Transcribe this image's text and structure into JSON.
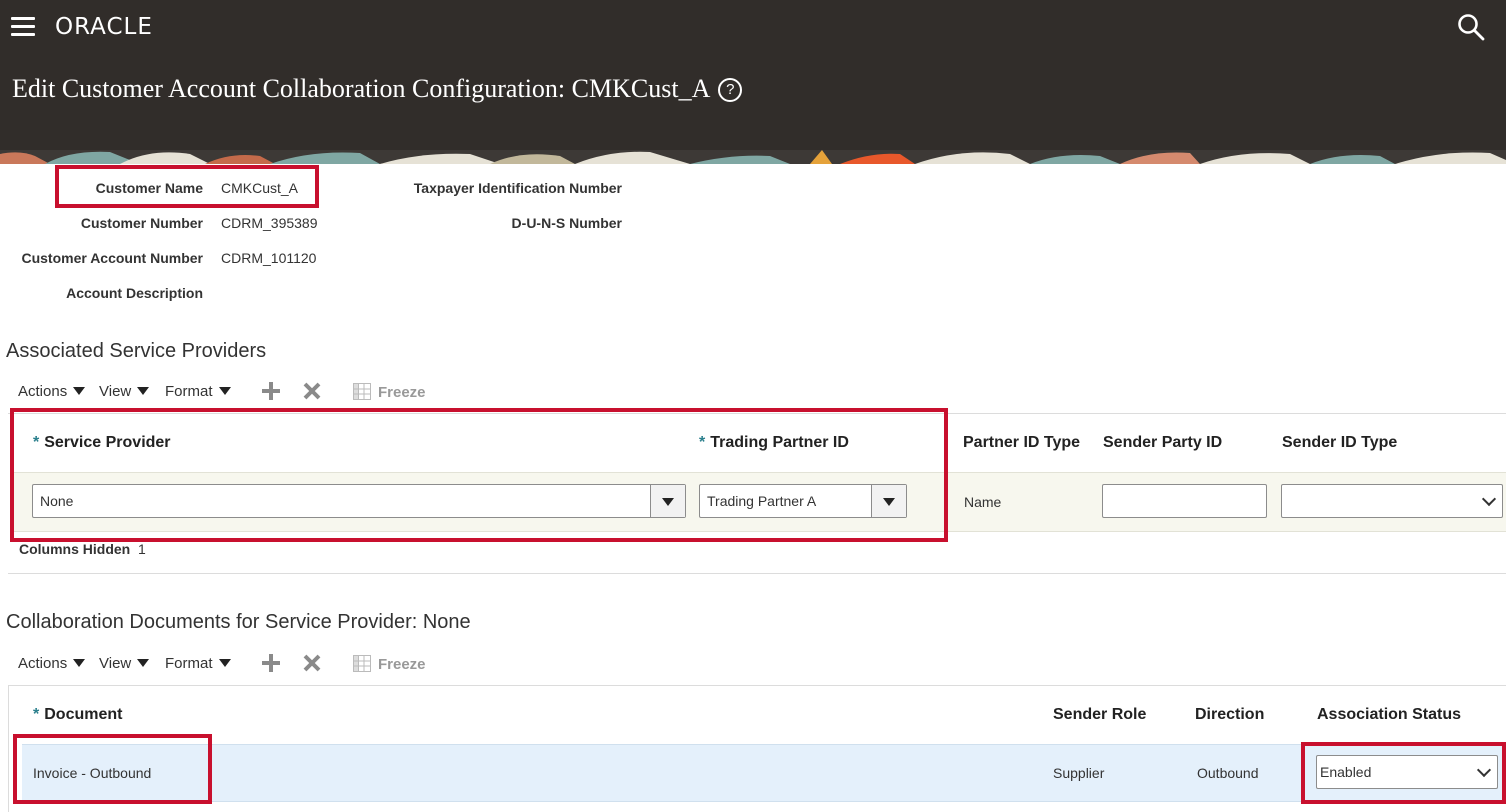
{
  "header": {
    "logo": "ORACLE",
    "title": "Edit Customer Account Collaboration Configuration: CMKCust_A",
    "help_glyph": "?"
  },
  "details": {
    "customer_name_label": "Customer Name",
    "customer_name": "CMKCust_A",
    "customer_number_label": "Customer Number",
    "customer_number": "CDRM_395389",
    "customer_account_number_label": "Customer Account Number",
    "customer_account_number": "CDRM_101120",
    "account_description_label": "Account Description",
    "taxpayer_label": "Taxpayer Identification Number",
    "duns_label": "D-U-N-S Number"
  },
  "providers": {
    "title": "Associated Service Providers",
    "toolbar": {
      "actions": "Actions",
      "view": "View",
      "format": "Format",
      "freeze": "Freeze"
    },
    "columns": {
      "service_provider": "Service Provider",
      "trading_partner_id": "Trading Partner ID",
      "partner_id_type": "Partner ID Type",
      "sender_party_id": "Sender Party ID",
      "sender_id_type": "Sender ID Type"
    },
    "row": {
      "service_provider": "None",
      "trading_partner_id": "Trading Partner A",
      "partner_id_type": "Name",
      "sender_party_id": "",
      "sender_id_type": ""
    },
    "columns_hidden_label": "Columns Hidden",
    "columns_hidden_count": "1"
  },
  "documents": {
    "title": "Collaboration Documents for Service Provider: None",
    "toolbar": {
      "actions": "Actions",
      "view": "View",
      "format": "Format",
      "freeze": "Freeze"
    },
    "columns": {
      "document": "Document",
      "sender_role": "Sender Role",
      "direction": "Direction",
      "association_status": "Association Status"
    },
    "row": {
      "document": "Invoice - Outbound",
      "sender_role": "Supplier",
      "direction": "Outbound",
      "association_status": "Enabled"
    }
  },
  "colors": {
    "header_bg": "#312d2a",
    "highlight_red": "#c8102e",
    "row_selected": "#e4f0fb",
    "row_edit": "#f7f7ee",
    "required_star": "#2a7f8c"
  }
}
